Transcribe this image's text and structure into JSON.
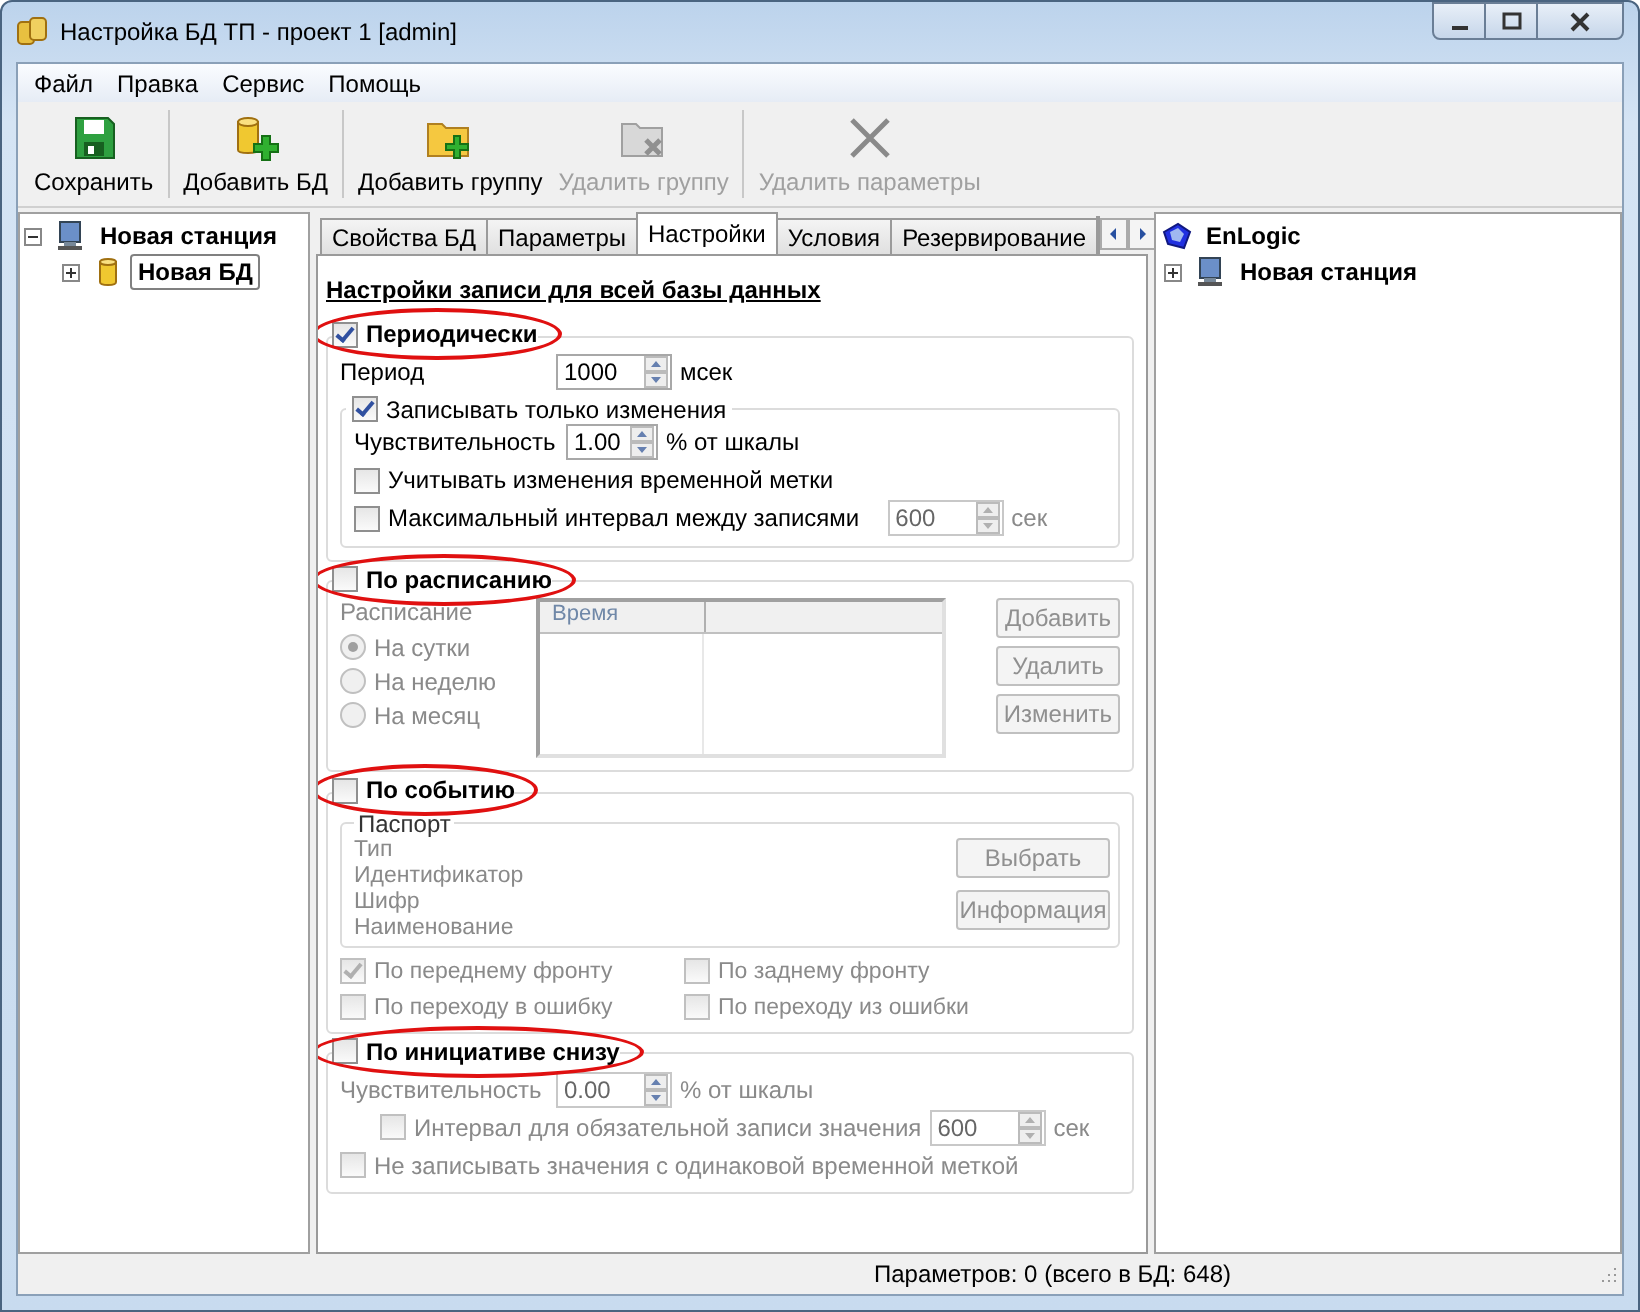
{
  "window": {
    "title": "Настройка БД ТП - проект 1 [admin]"
  },
  "menu": [
    "Файл",
    "Правка",
    "Сервис",
    "Помощь"
  ],
  "toolbar": [
    {
      "label": "Сохранить",
      "disabled": false,
      "separator_after": true
    },
    {
      "label": "Добавить БД",
      "disabled": false,
      "separator_after": true
    },
    {
      "label": "Добавить группу",
      "disabled": false,
      "separator_after": false
    },
    {
      "label": "Удалить группу",
      "disabled": true,
      "separator_after": true
    },
    {
      "label": "Удалить параметры",
      "disabled": true,
      "separator_after": false
    }
  ],
  "left_tree": [
    {
      "label": "Новая станция",
      "expanded": true,
      "selected": false,
      "children": [
        {
          "label": "Новая БД",
          "expanded": false,
          "selected": true
        }
      ]
    }
  ],
  "tabs": [
    {
      "label": "Свойства БД",
      "selected": false
    },
    {
      "label": "Параметры",
      "selected": false
    },
    {
      "label": "Настройки",
      "selected": true
    },
    {
      "label": "Условия",
      "selected": false
    },
    {
      "label": "Резервирование",
      "selected": false
    }
  ],
  "heading": "Настройки записи для всей базы данных",
  "periodic": {
    "label": "Периодически",
    "checked": true,
    "enabled": true,
    "highlighted": true,
    "rows": [
      {
        "kind": "spin",
        "label": "Период",
        "value": "1000",
        "unit": "мсек"
      }
    ],
    "subgroup": {
      "label": "Записывать только изменения",
      "checked": true,
      "rows": [
        {
          "kind": "spin",
          "label": "Чувствительность",
          "value": "1.00",
          "unit": "% от шкалы"
        },
        {
          "kind": "check",
          "label": "Учитывать изменения временной метки",
          "checked": false
        },
        {
          "kind": "checkspin",
          "label": "Максимальный интервал между записями",
          "checked": false,
          "value": "600",
          "unit": "сек",
          "disabled": true
        }
      ]
    }
  },
  "schedule": {
    "label": "По расписанию",
    "checked": false,
    "enabled": false,
    "highlighted": true,
    "caption": "Расписание",
    "radios": [
      {
        "label": "На сутки",
        "selected": true
      },
      {
        "label": "На неделю",
        "selected": false
      },
      {
        "label": "На месяц",
        "selected": false
      }
    ],
    "table": {
      "columns": [
        "Время"
      ]
    },
    "buttons": [
      "Добавить",
      "Удалить",
      "Изменить"
    ]
  },
  "event": {
    "label": "По событию",
    "checked": false,
    "enabled": false,
    "highlighted": true,
    "passport": {
      "title": "Паспорт",
      "fields": [
        "Тип",
        "Идентификатор",
        "Шифр",
        "Наименование"
      ],
      "buttons": [
        "Выбрать",
        "Информация"
      ]
    },
    "options": [
      {
        "label": "По переднему фронту",
        "checked": true
      },
      {
        "label": "По заднему фронту",
        "checked": false
      },
      {
        "label": "По переходу в ошибку",
        "checked": false
      },
      {
        "label": "По переходу из ошибки",
        "checked": false
      }
    ]
  },
  "bottom": {
    "label": "По инициативе снизу",
    "checked": false,
    "enabled": false,
    "highlighted": true,
    "rows": [
      {
        "kind": "spin",
        "label": "Чувствительность",
        "value": "0.00",
        "unit": "% от шкалы"
      },
      {
        "kind": "checkspin",
        "label": "Интервал для обязательной записи значения",
        "checked": false,
        "value": "600",
        "unit": "сек"
      },
      {
        "kind": "check",
        "label": "Не записывать значения с одинаковой временной меткой",
        "checked": false
      }
    ]
  },
  "right_tree": {
    "root": "EnLogic",
    "items": [
      {
        "label": "Новая станция",
        "expanded": false
      }
    ]
  },
  "status_bar": "Параметров: 0 (всего в БД: 648)"
}
